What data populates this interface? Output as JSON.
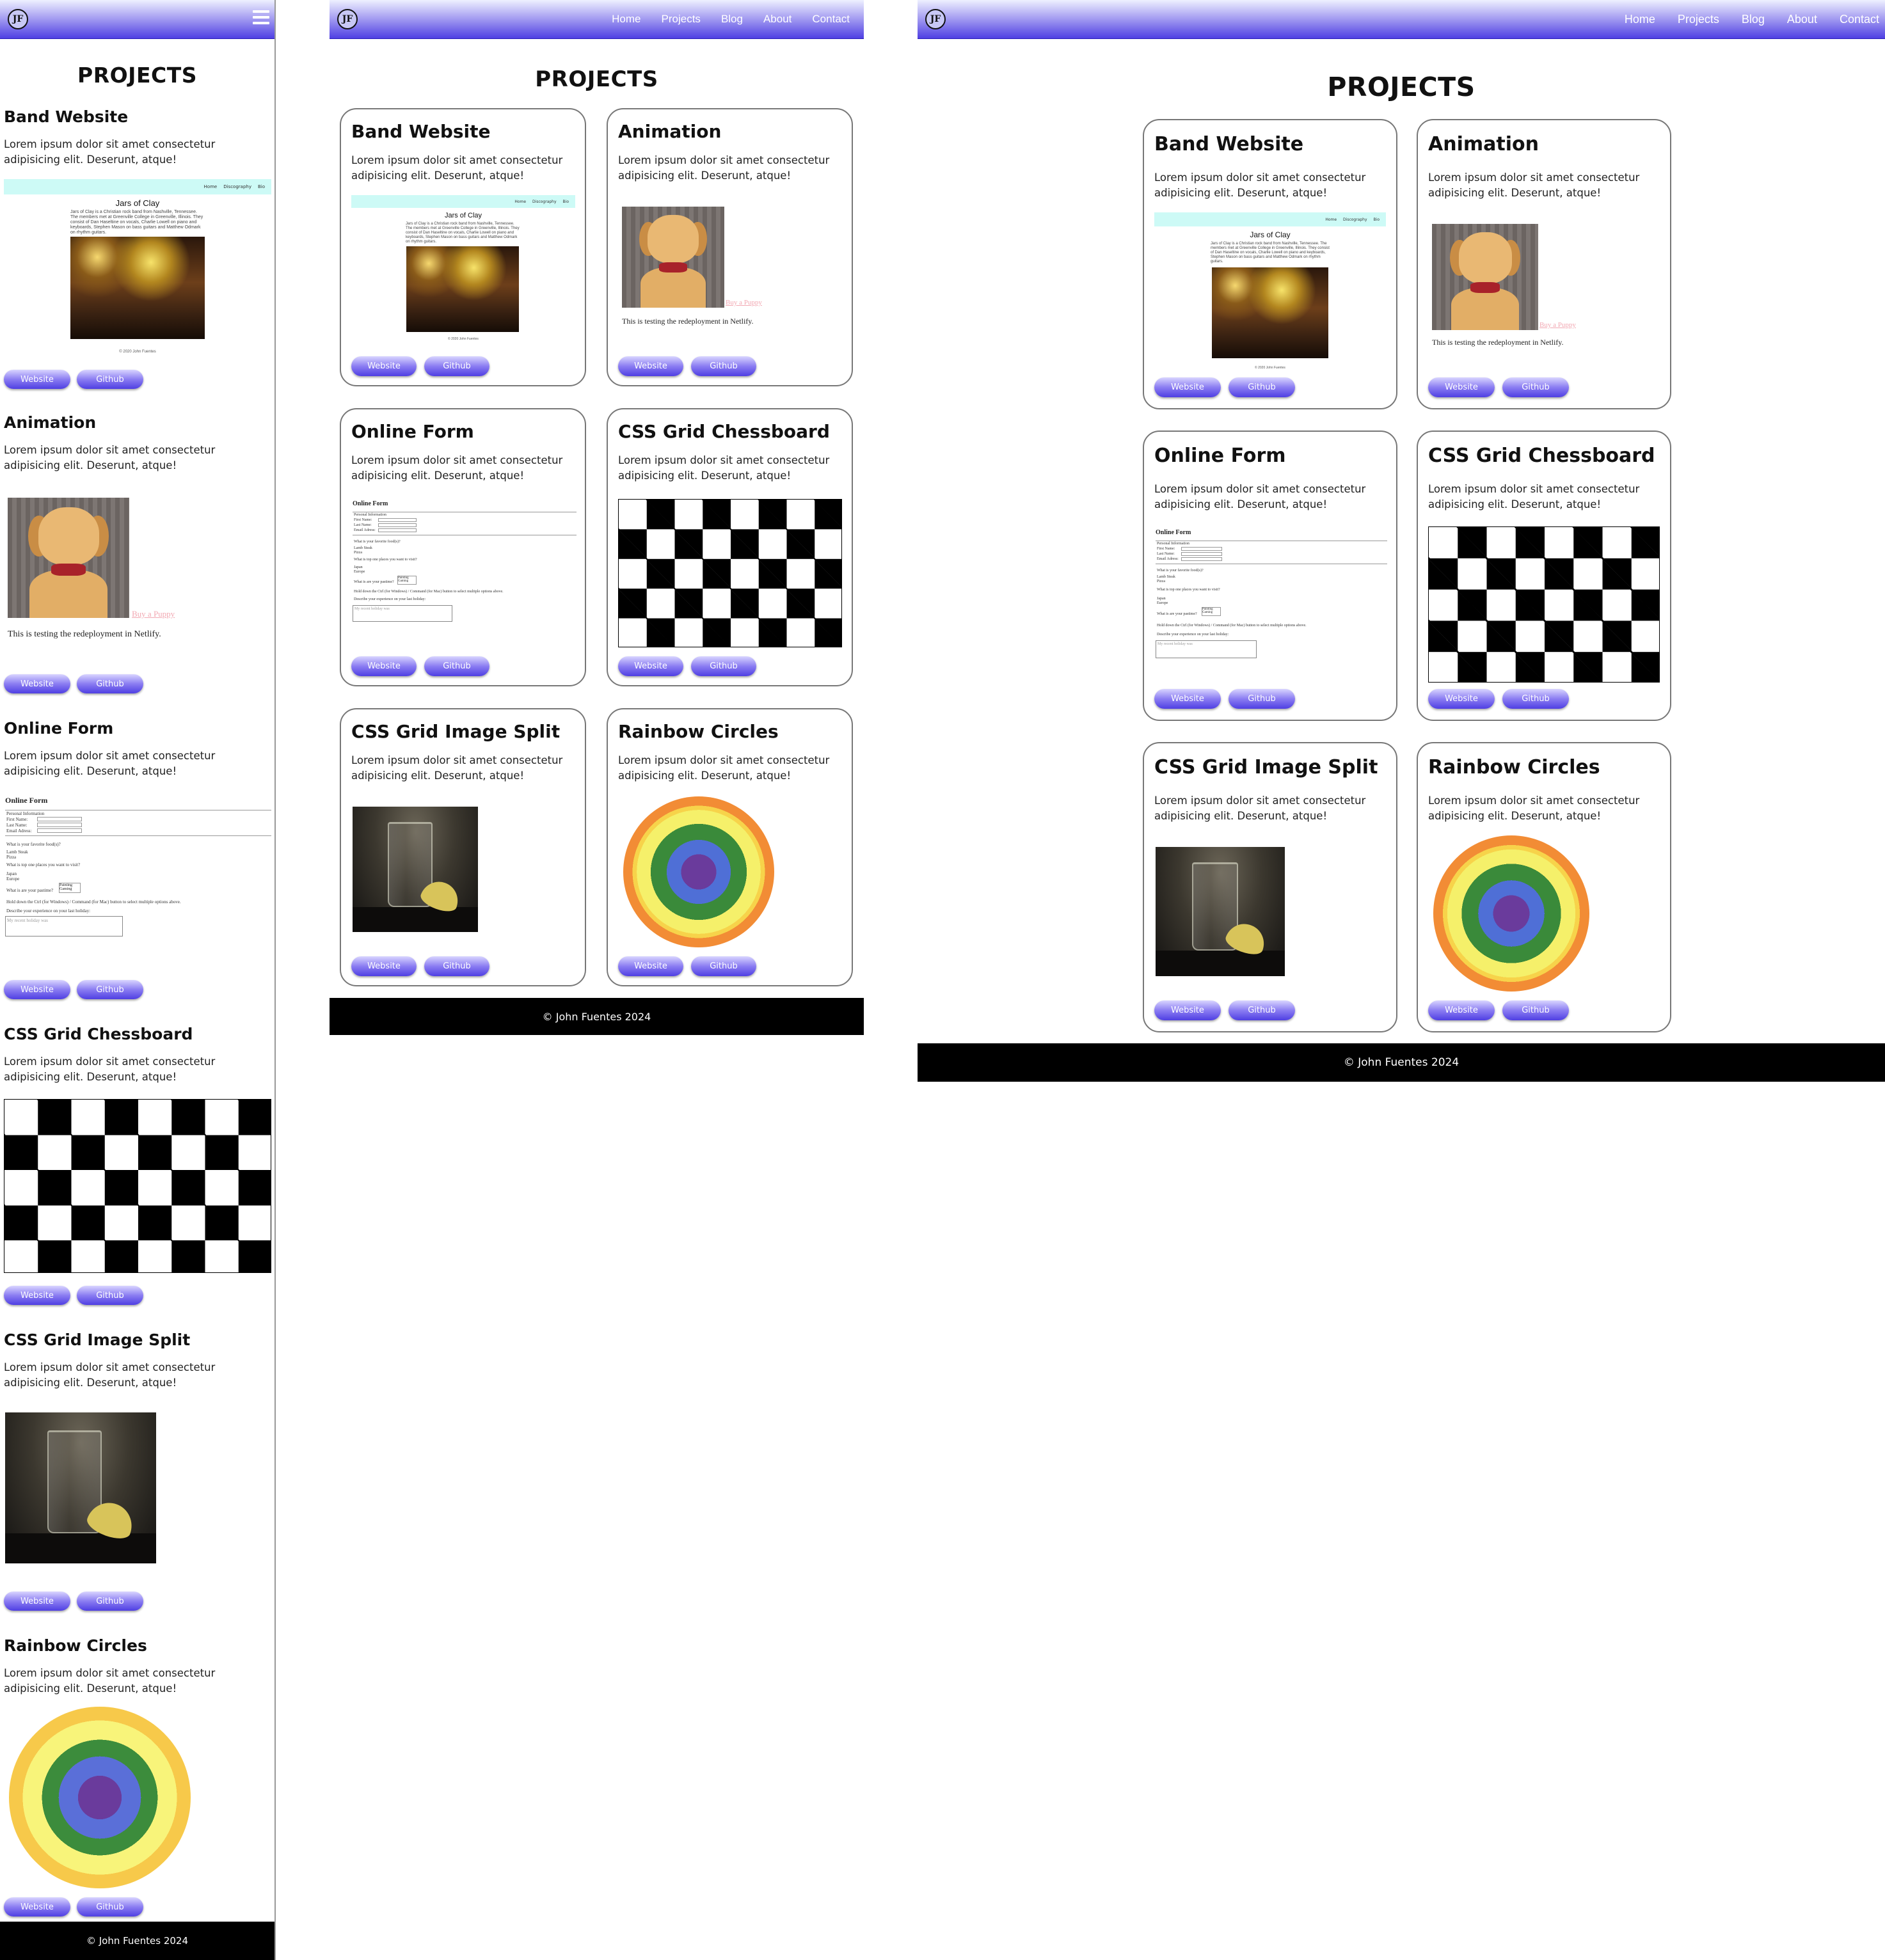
{
  "brand": {
    "logo": "JF"
  },
  "nav": {
    "items": [
      "Home",
      "Projects",
      "Blog",
      "About",
      "Contact"
    ]
  },
  "page": {
    "title": "PROJECTS"
  },
  "projects": [
    {
      "title": "Band Website",
      "description": "Lorem ipsum dolor sit amet consectetur adipisicing elit. Deserunt, atque!",
      "preview": "band"
    },
    {
      "title": "Animation",
      "description": "Lorem ipsum dolor sit amet consectetur adipisicing elit. Deserunt, atque!",
      "preview": "puppy"
    },
    {
      "title": "Online Form",
      "description": "Lorem ipsum dolor sit amet consectetur adipisicing elit. Deserunt, atque!",
      "preview": "form"
    },
    {
      "title": "CSS Grid Chessboard",
      "description": "Lorem ipsum dolor sit amet consectetur adipisicing elit. Deserunt, atque!",
      "preview": "chess"
    },
    {
      "title": "CSS Grid Image Split",
      "description": "Lorem ipsum dolor sit amet consectetur adipisicing elit. Deserunt, atque!",
      "preview": "glass"
    },
    {
      "title": "Rainbow Circles",
      "description": "Lorem ipsum dolor sit amet consectetur adipisicing elit. Deserunt, atque!",
      "preview": "rainbow"
    }
  ],
  "buttons": {
    "website": "Website",
    "github": "Github"
  },
  "band_preview": {
    "nav": [
      "Home",
      "Discography",
      "Bio"
    ],
    "heading": "Jars of Clay",
    "text": "Jars of Clay is a Christian rock band from Nashville, Tennessee. The members met at Greenville College in Greenville, Illinois. They consist of Dan Haseltine on vocals, Charlie Lowell on piano and keyboards, Stephen Mason on bass guitars and Matthew Odmark on rhythm guitars.",
    "footer": "© 2020 John Fuentes"
  },
  "puppy_preview": {
    "link": "Buy a Puppy",
    "text": "This is testing the redeployment in Netlify."
  },
  "form_preview": {
    "heading": "Online Form",
    "legend": "Personal Information",
    "fields": [
      "First Name:",
      "Last Name:",
      "Email Adress:"
    ],
    "q_food": "What is your favorite food(s)?",
    "foods": [
      "Lamb Steak",
      "Pizza"
    ],
    "q_trip": "What is top one places you want to visit?",
    "places": [
      "Japan",
      "Europe"
    ],
    "q_pastime": "What is are your pastime?",
    "pastimes": [
      "Painting",
      "Gaming"
    ],
    "hint": "Hold down the Ctrl (for Windows) / Command (for Mac) button to select multiple options above.",
    "q_holiday": "Describe your experience on your last holiday:",
    "placeholder": "My recent holiday was"
  },
  "footer": {
    "text": "© John Fuentes 2024"
  },
  "colors": {
    "nav_start": "#eef0ff",
    "nav_end": "#4f3fe3",
    "button_accent": "#6a5ae8",
    "footer": "#000000"
  }
}
